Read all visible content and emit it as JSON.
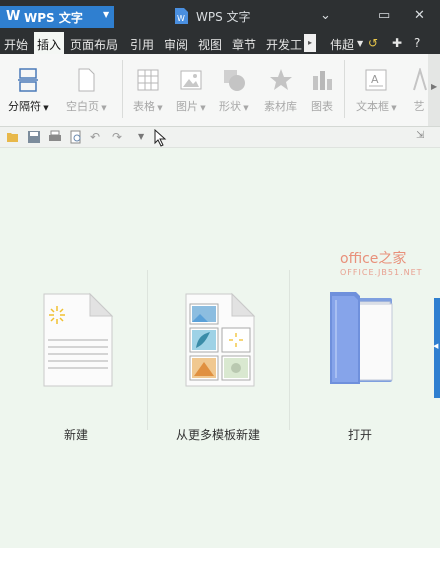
{
  "titlebar": {
    "app_logo": "W",
    "app_name": "WPS 文字",
    "window_title": "WPS 文字",
    "minimize": "⌄",
    "restore": "▭",
    "close": "✕"
  },
  "menu": {
    "tabs": [
      "开始",
      "插入",
      "页面布局",
      "引用",
      "审阅",
      "视图",
      "章节",
      "开发工"
    ],
    "active_tab": "插入",
    "more": "▸",
    "user": "伟超",
    "help": "?"
  },
  "ribbon": {
    "items": [
      {
        "label": "分隔符",
        "icon": "page-break-icon"
      },
      {
        "label": "空白页",
        "icon": "blank-page-icon"
      },
      {
        "label": "表格",
        "icon": "table-icon"
      },
      {
        "label": "图片",
        "icon": "picture-icon"
      },
      {
        "label": "形状",
        "icon": "shape-icon"
      },
      {
        "label": "素材库",
        "icon": "star-icon"
      },
      {
        "label": "图表",
        "icon": "chart-icon"
      },
      {
        "label": "文本框",
        "icon": "text-box-icon"
      },
      {
        "label": "艺",
        "icon": "art-icon"
      }
    ]
  },
  "watermark": {
    "brand": "office之家",
    "site": "OFFICE.JB51.NET"
  },
  "start": {
    "new_label": "新建",
    "template_label": "从更多模板新建",
    "open_label": "打开"
  },
  "colors": {
    "title_bg": "#2d3032",
    "accent": "#2f7fd0",
    "workspace": "#eef6ee"
  }
}
